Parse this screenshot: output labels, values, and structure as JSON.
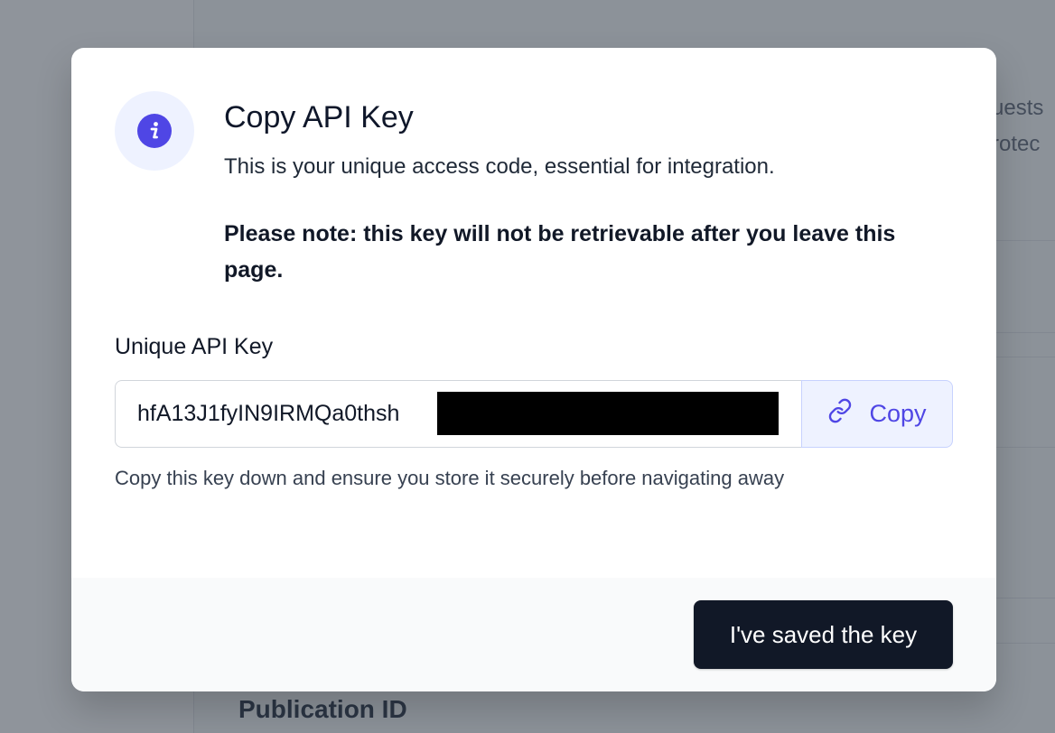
{
  "background": {
    "partial_text_1": "uests",
    "partial_text_2": "rotec",
    "publication_id_label": "Publication ID"
  },
  "modal": {
    "title": "Copy API Key",
    "description": "This is your unique access code, essential for integration.",
    "note": "Please note: this key will not be retrievable after you leave this page.",
    "field_label": "Unique API Key",
    "api_key_value": "hfA13J1fyIN9IRMQa0thsh",
    "copy_label": "Copy",
    "helper_text": "Copy this key down and ensure you store it securely before navigating away",
    "confirm_label": "I've saved the key",
    "icons": {
      "badge": "info-icon",
      "copy": "link-icon"
    },
    "colors": {
      "accent": "#4f46e5",
      "accent_light": "#eef2ff",
      "primary_button": "#111827",
      "redaction": "#000000"
    }
  }
}
